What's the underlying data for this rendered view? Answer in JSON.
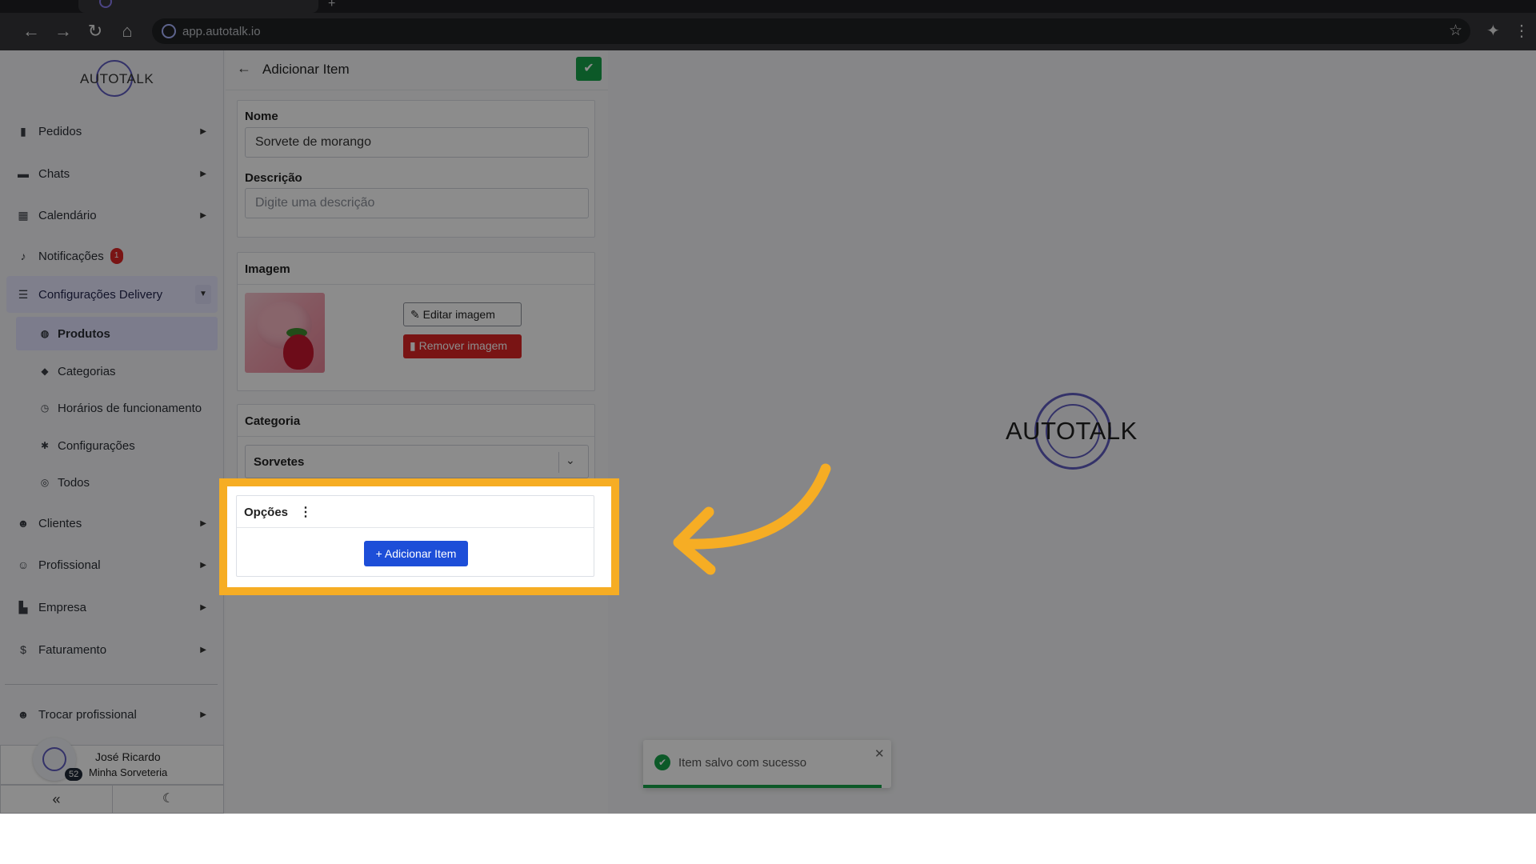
{
  "browser": {
    "url": "app.autotalk.io"
  },
  "sidebar": {
    "brand": "AUTOTALK",
    "items": [
      {
        "label": "Pedidos"
      },
      {
        "label": "Chats"
      },
      {
        "label": "Calendário"
      },
      {
        "label": "Notificações",
        "badge": "1"
      },
      {
        "label": "Configurações Delivery",
        "expanded": true
      },
      {
        "label": "Clientes"
      },
      {
        "label": "Profissional"
      },
      {
        "label": "Empresa"
      },
      {
        "label": "Faturamento"
      }
    ],
    "subitems": [
      {
        "label": "Produtos",
        "active": true
      },
      {
        "label": "Categorias"
      },
      {
        "label": "Horários de funcionamento"
      },
      {
        "label": "Configurações"
      },
      {
        "label": "Todos"
      }
    ],
    "switch_professional": "Trocar profissional",
    "user": {
      "name": "José Ricardo",
      "org": "Minha Sorveteria",
      "count": "52"
    }
  },
  "form": {
    "title": "Adicionar Item",
    "name_label": "Nome",
    "name_value": "Sorvete de morango",
    "description_label": "Descrição",
    "description_placeholder": "Digite uma descrição",
    "image_label": "Imagem",
    "edit_image": "Editar imagem",
    "remove_image": "Remover imagem",
    "category_label": "Categoria",
    "category_value": "Sorvetes",
    "options_label": "Opções",
    "add_item": "Adicionar Item"
  },
  "right": {
    "logo": "AUTOTALK"
  },
  "toast": {
    "message": "Item salvo com sucesso",
    "progress": 0.96
  },
  "colors": {
    "accent": "#f6ad24",
    "primary": "#1d4ed8",
    "success": "#16a34a",
    "danger": "#dc2626"
  }
}
